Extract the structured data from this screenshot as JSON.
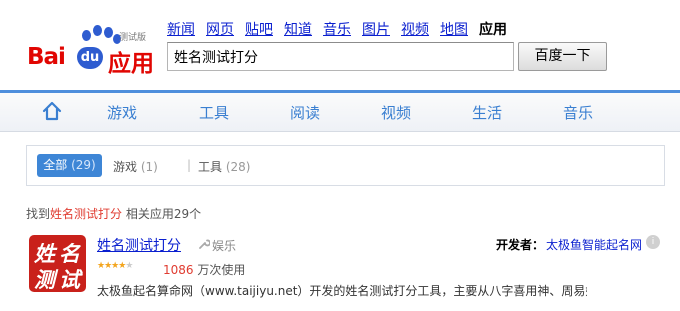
{
  "logo": {
    "sub": "测试版",
    "bai": "Bai",
    "du": "du",
    "yingyong": "应用"
  },
  "nav": {
    "items": [
      "新闻",
      "网页",
      "贴吧",
      "知道",
      "音乐",
      "图片",
      "视频",
      "地图"
    ],
    "active": "应用"
  },
  "search": {
    "value": "姓名测试打分",
    "button": "百度一下"
  },
  "categories": [
    "游戏",
    "工具",
    "阅读",
    "视频",
    "生活",
    "音乐"
  ],
  "filter": {
    "all_label": "全部",
    "all_count": "(29)",
    "game_label": "游戏",
    "game_count": "(1)",
    "sep": "|",
    "tool_label": "工具",
    "tool_count": "(28)"
  },
  "summary": {
    "prefix": "找到",
    "query": "姓名测试打分",
    "suffix": "相关应用29个"
  },
  "result": {
    "icon_chars": [
      "姓",
      "名",
      "测",
      "试"
    ],
    "title": "姓名测试打分",
    "category": "娱乐",
    "developer_label": "开发者：",
    "developer": "太极鱼智能起名网",
    "rating": 4,
    "rating_max": 5,
    "downloads": "1086",
    "downloads_unit": "万次使用",
    "description": "太极鱼起名算命网（www.taijiyu.net）开发的姓名测试打分工具，主要从八字喜用神、周易姓名学…"
  }
}
